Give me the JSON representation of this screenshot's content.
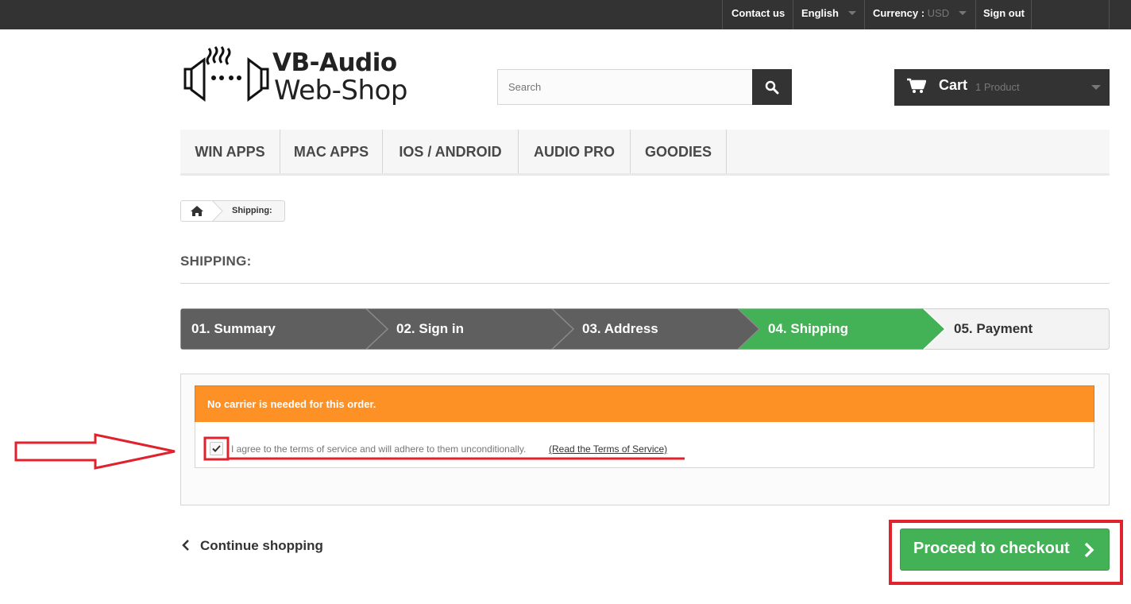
{
  "topbar": {
    "contact_label": "Contact us",
    "language_label": "English",
    "currency_prefix": "Currency :",
    "currency_value": "USD",
    "signout_label": "Sign out"
  },
  "header": {
    "logo_title": "VB-Audio",
    "logo_subtitle": "Web-Shop",
    "search_placeholder": "Search",
    "search_icon": "search-icon",
    "cart_label": "Cart",
    "cart_quantity": "1 Product",
    "cart_icon": "shopping-cart-icon"
  },
  "menu": {
    "items": [
      {
        "label": "WIN APPS"
      },
      {
        "label": "MAC APPS"
      },
      {
        "label": "IOS / ANDROID"
      },
      {
        "label": "AUDIO PRO"
      },
      {
        "label": "GOODIES"
      }
    ]
  },
  "breadcrumb": {
    "home_icon": "home-icon",
    "current": "Shipping:"
  },
  "page": {
    "title": "SHIPPING:"
  },
  "steps": [
    {
      "label": "01. Summary",
      "state": "done"
    },
    {
      "label": "02. Sign in",
      "state": "done"
    },
    {
      "label": "03. Address",
      "state": "done"
    },
    {
      "label": "04. Shipping",
      "state": "current"
    },
    {
      "label": "05. Payment",
      "state": "todo"
    }
  ],
  "shipping": {
    "carrier_notice": "No carrier is needed for this order.",
    "terms_checked": true,
    "terms_text": "I agree to the terms of service and will adhere to them unconditionally.",
    "terms_link": "(Read the Terms of Service)"
  },
  "actions": {
    "continue_label": "Continue shopping",
    "checkout_label": "Proceed to checkout"
  },
  "colors": {
    "topbar": "#333333",
    "step_done": "#5f5f5f",
    "step_current": "#43b155",
    "alert": "#fe9126",
    "checkout": "#43b155",
    "annotation": "#e0222d"
  }
}
